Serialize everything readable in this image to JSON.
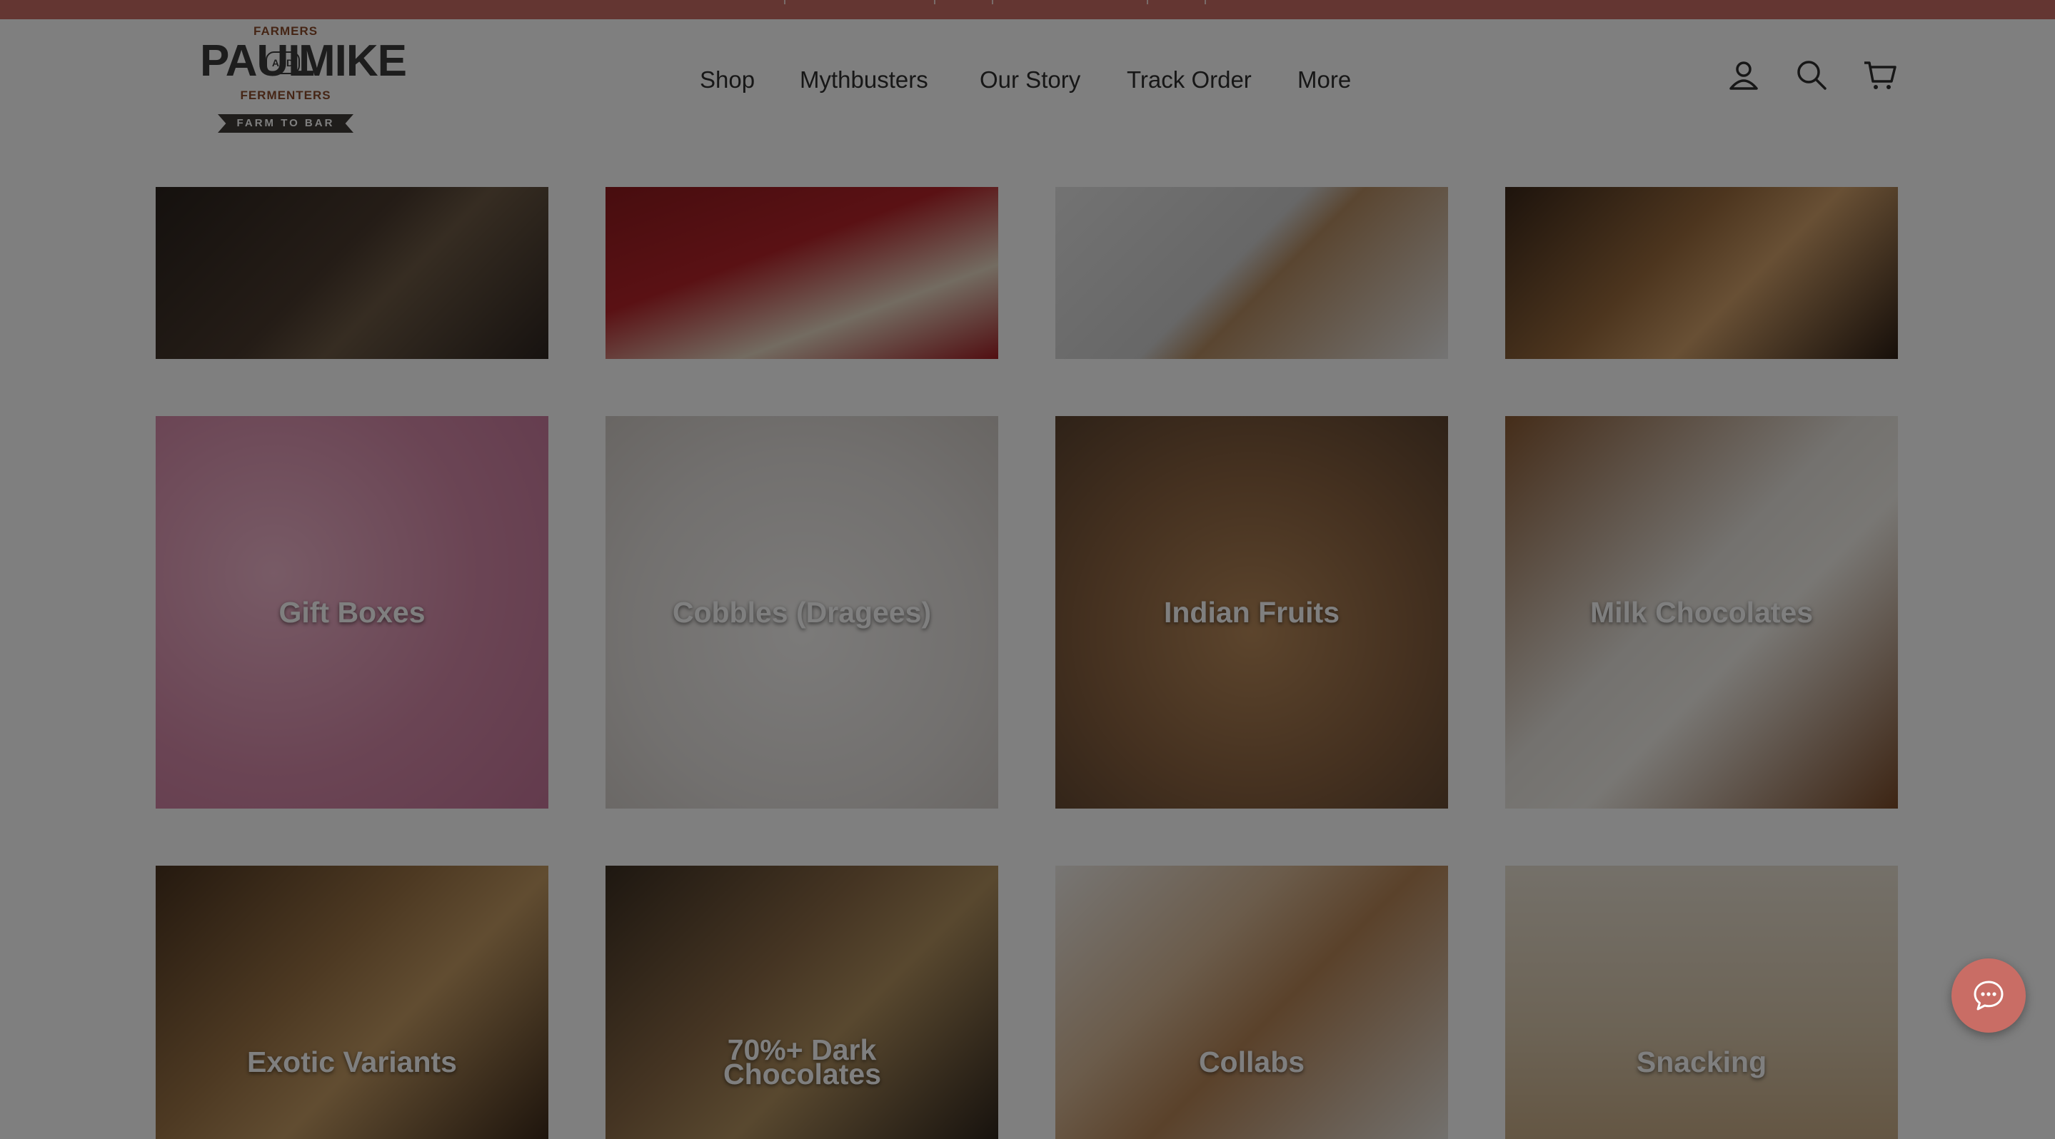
{
  "logo": {
    "top_text": "FARMERS",
    "name_left": "PAUL",
    "name_mid": "AND",
    "name_right": "MIKE",
    "sub_text": "FERMENTERS",
    "ribbon_text": "FARM TO BAR"
  },
  "nav": {
    "items": [
      "Shop",
      "Mythbusters",
      "Our Story",
      "Track Order",
      "More"
    ]
  },
  "header_icons": [
    "account-icon",
    "search-icon",
    "cart-icon"
  ],
  "collections": [
    {
      "label": "",
      "bg": "#3b2f27"
    },
    {
      "label": "",
      "bg": "#9b1b20"
    },
    {
      "label": "",
      "bg": "#d9d9d9"
    },
    {
      "label": "",
      "bg": "#7a4c2b"
    },
    {
      "label": "Gift Boxes",
      "bg": "#d79ab5"
    },
    {
      "label": "Cobbles (Dragees)",
      "bg": "#e9e6e4"
    },
    {
      "label": "Indian Fruits",
      "bg": "#7e5a3a"
    },
    {
      "label": "Milk Chocolates",
      "bg": "#6b4428"
    },
    {
      "label": "Exotic Variants",
      "bg": "#6a4a2d"
    },
    {
      "label": "70%+ Dark Chocolates",
      "bg": "#5b4a36"
    },
    {
      "label": "Collabs",
      "bg": "#d8d4ce"
    },
    {
      "label": "Snacking",
      "bg": "#e6ddd0"
    }
  ],
  "colors": {
    "topbar": "#c96d65",
    "chat_button": "#c96d65",
    "modal_overlay": "rgba(0,0,0,0.5)"
  },
  "chat_button_icon": "chat-bubble-icon"
}
